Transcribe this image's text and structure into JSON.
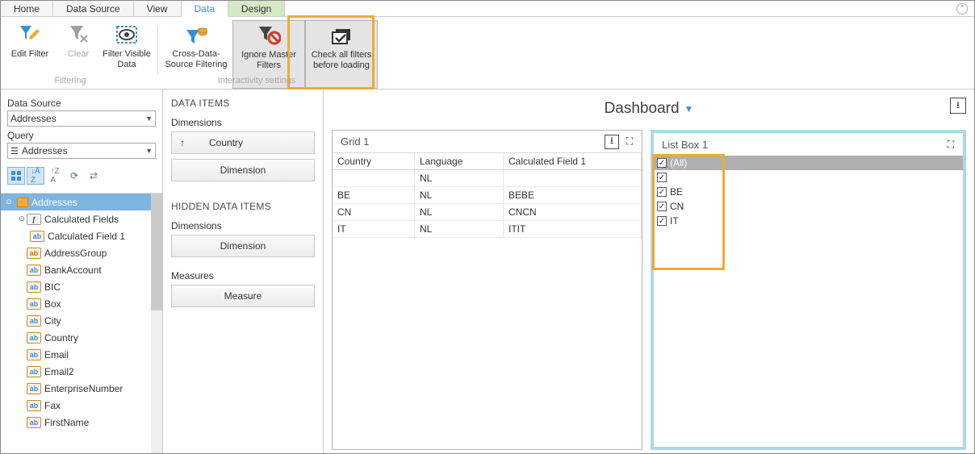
{
  "tabs": {
    "home": "Home",
    "data_source": "Data Source",
    "view": "View",
    "data": "Data",
    "design": "Design"
  },
  "ribbon": {
    "edit_filter": "Edit Filter",
    "clear": "Clear",
    "filter_visible": "Filter Visible Data",
    "cross_ds": "Cross-Data-Source Filtering",
    "ignore_master": "Ignore Master Filters",
    "check_all": "Check all filters before loading",
    "group_filtering": "Filtering",
    "group_interactivity": "Interactivity settings"
  },
  "left": {
    "data_source_label": "Data Source",
    "data_source_val": "Addresses",
    "query_label": "Query",
    "query_val": "Addresses",
    "tree_root": "Addresses",
    "calculated_fields": "Calculated Fields",
    "calculated_field_1": "Calculated Field 1",
    "fields": [
      "AddressGroup",
      "BankAccount",
      "BIC",
      "Box",
      "City",
      "Country",
      "Email",
      "Email2",
      "EnterpriseNumber",
      "Fax",
      "FirstName"
    ]
  },
  "mid": {
    "data_items": "DATA ITEMS",
    "dimensions": "Dimensions",
    "country": "Country",
    "dimension": "Dimension",
    "hidden_data_items": "HIDDEN DATA ITEMS",
    "measures": "Measures",
    "measure": "Measure"
  },
  "dashboard": {
    "title": "Dashboard",
    "grid_title": "Grid 1",
    "listbox_title": "List Box 1",
    "columns": [
      "Country",
      "Language",
      "Calculated Field 1"
    ],
    "rows": [
      {
        "c": "",
        "l": "NL",
        "f": ""
      },
      {
        "c": "BE",
        "l": "NL",
        "f": "BEBE"
      },
      {
        "c": "CN",
        "l": "NL",
        "f": "CNCN"
      },
      {
        "c": "IT",
        "l": "NL",
        "f": "ITIT"
      }
    ],
    "listbox_all": "(All)",
    "listbox_items": [
      "",
      "BE",
      "CN",
      "IT"
    ]
  },
  "sort_arrow": "↑"
}
